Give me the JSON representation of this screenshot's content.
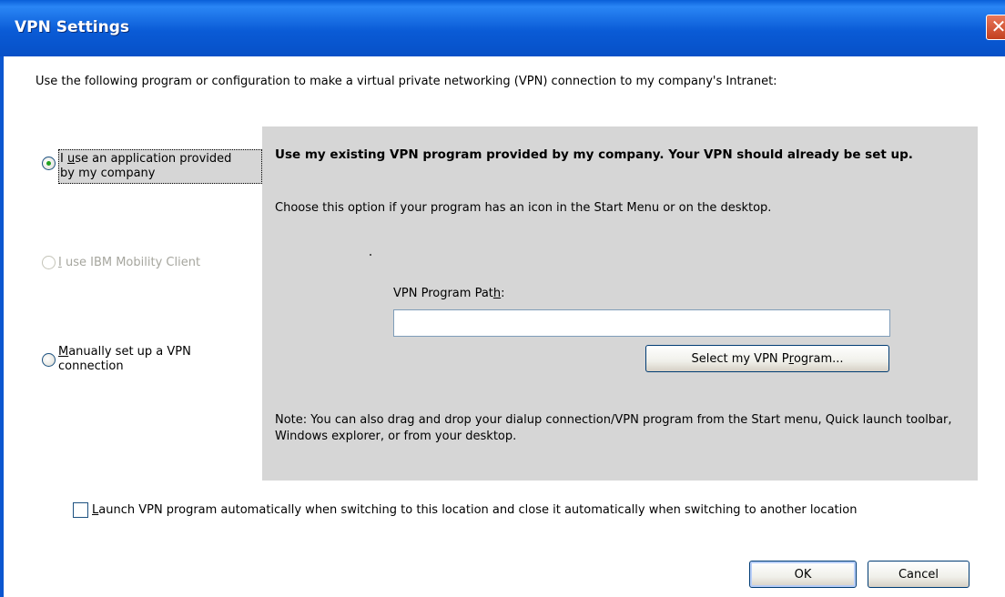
{
  "window": {
    "title": "VPN Settings",
    "close_label": "✕"
  },
  "intro": "Use the following program or configuration to make a virtual private networking (VPN) connection to my company's Intranet:",
  "options": [
    {
      "line1_pre": "I ",
      "line1_key": "u",
      "line1_post": "se an application provided",
      "line2": "by my company",
      "selected": true,
      "enabled": true
    },
    {
      "line1_pre": "",
      "line1_key": "I",
      "line1_post": " use IBM Mobility Client",
      "line2": "",
      "selected": false,
      "enabled": false
    },
    {
      "line1_pre": "",
      "line1_key": "M",
      "line1_post": "anually set up a VPN",
      "line2": "connection",
      "selected": false,
      "enabled": true
    }
  ],
  "panel": {
    "heading": "Use my existing VPN program provided by my company.  Your VPN should already be set up.",
    "subtext": "Choose this option if your program has an icon in the Start Menu or on the desktop.",
    "path_label_pre": "VPN Program Pat",
    "path_label_key": "h",
    "path_label_post": ":",
    "path_value": "",
    "select_button_pre": "Select my VPN P",
    "select_button_key": "r",
    "select_button_post": "ogram...",
    "note": "Note: You can also drag and drop your dialup connection/VPN program from the Start menu, Quick launch toolbar, Windows explorer, or from your desktop."
  },
  "auto_launch": {
    "key": "L",
    "label_post": "aunch VPN program automatically when switching to this location and close it automatically when switching to another location",
    "checked": false
  },
  "buttons": {
    "ok": "OK",
    "cancel": "Cancel"
  }
}
